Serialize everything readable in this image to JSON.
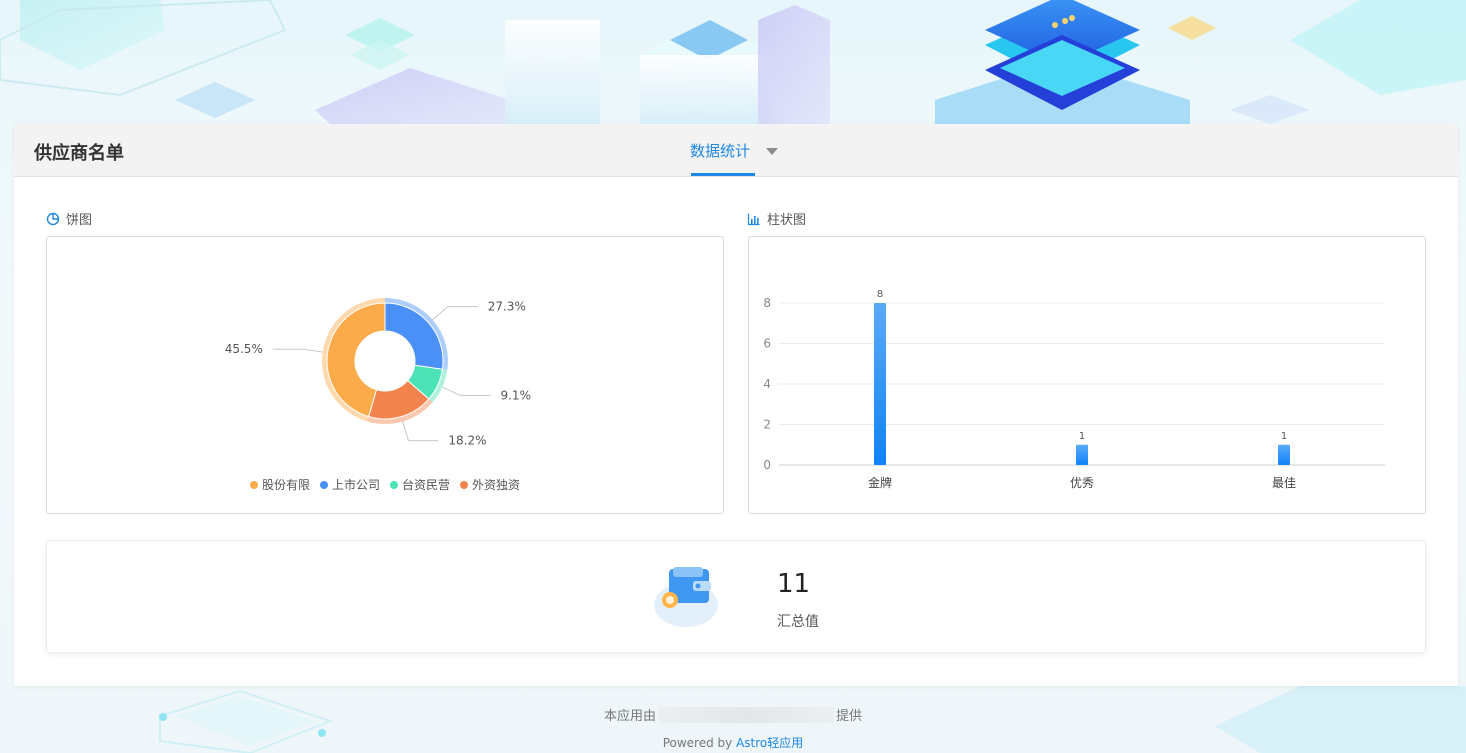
{
  "header": {
    "title": "供应商名单",
    "tab_label": "数据统计"
  },
  "pie_section": {
    "label": "饼图",
    "icon": "pie-chart-icon"
  },
  "bar_section": {
    "label": "柱状图",
    "icon": "bar-chart-icon"
  },
  "summary": {
    "value": "11",
    "label": "汇总值",
    "icon": "wallet-icon"
  },
  "footer": {
    "provided_prefix": "本应用由",
    "provided_suffix": "提供",
    "powered_by": "Powered by",
    "powered_link": "Astro轻应用"
  },
  "chart_data": [
    {
      "type": "pie",
      "donut": true,
      "categories": [
        "股份有限",
        "上市公司",
        "台资民营",
        "外资独资"
      ],
      "values": [
        5,
        3,
        1,
        2
      ],
      "percent_labels": [
        "45.5%",
        "27.3%",
        "9.1%",
        "18.2%"
      ],
      "colors": [
        "#fbab4a",
        "#4a90f7",
        "#4be3b5",
        "#f3834d"
      ],
      "legend": "bottom"
    },
    {
      "type": "bar",
      "categories": [
        "金牌",
        "优秀",
        "最佳"
      ],
      "values": [
        8,
        1,
        1
      ],
      "ylim": [
        0,
        8
      ],
      "yticks": [
        0,
        2,
        4,
        6,
        8
      ],
      "grid": true,
      "colors": [
        "#1e88fa"
      ]
    }
  ]
}
